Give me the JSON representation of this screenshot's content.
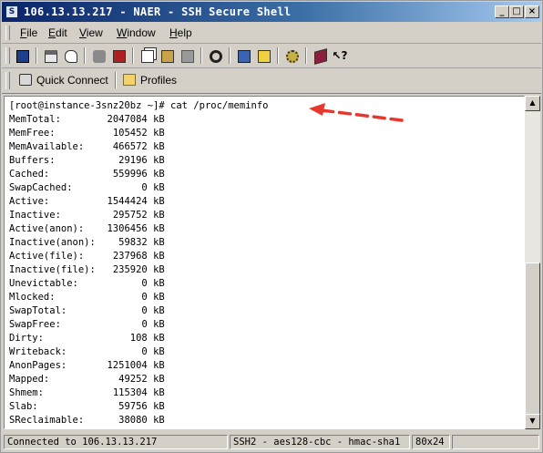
{
  "window": {
    "title": "106.13.13.217 - NAER - SSH Secure Shell",
    "controls": {
      "minimize": "_",
      "maximize": "□",
      "close": "×"
    }
  },
  "menu": [
    {
      "label": "File",
      "accel": "F",
      "rest": "ile"
    },
    {
      "label": "Edit",
      "accel": "E",
      "rest": "dit"
    },
    {
      "label": "View",
      "accel": "V",
      "rest": "iew"
    },
    {
      "label": "Window",
      "accel": "W",
      "rest": "indow"
    },
    {
      "label": "Help",
      "accel": "H",
      "rest": "elp"
    }
  ],
  "toolbar": {
    "icons": [
      "save-icon",
      "print-icon",
      "print-preview-icon",
      "disconnect-icon",
      "new-connection-icon",
      "copy-icon",
      "paste-icon",
      "paste-special-icon",
      "find-icon",
      "file-transfer-icon",
      "new-window-icon",
      "settings-icon",
      "book-icon",
      "help-icon"
    ]
  },
  "quickbar": {
    "quick_connect": "Quick Connect",
    "profiles": "Profiles"
  },
  "terminal": {
    "prompt": "[root@instance-3snz20bz ~]#",
    "command": "cat /proc/meminfo",
    "rows": [
      {
        "key": "MemTotal:",
        "value": "2047084",
        "unit": "kB"
      },
      {
        "key": "MemFree:",
        "value": "105452",
        "unit": "kB"
      },
      {
        "key": "MemAvailable:",
        "value": "466572",
        "unit": "kB"
      },
      {
        "key": "Buffers:",
        "value": "29196",
        "unit": "kB"
      },
      {
        "key": "Cached:",
        "value": "559996",
        "unit": "kB"
      },
      {
        "key": "SwapCached:",
        "value": "0",
        "unit": "kB"
      },
      {
        "key": "Active:",
        "value": "1544424",
        "unit": "kB"
      },
      {
        "key": "Inactive:",
        "value": "295752",
        "unit": "kB"
      },
      {
        "key": "Active(anon):",
        "value": "1306456",
        "unit": "kB"
      },
      {
        "key": "Inactive(anon):",
        "value": "59832",
        "unit": "kB"
      },
      {
        "key": "Active(file):",
        "value": "237968",
        "unit": "kB"
      },
      {
        "key": "Inactive(file):",
        "value": "235920",
        "unit": "kB"
      },
      {
        "key": "Unevictable:",
        "value": "0",
        "unit": "kB"
      },
      {
        "key": "Mlocked:",
        "value": "0",
        "unit": "kB"
      },
      {
        "key": "SwapTotal:",
        "value": "0",
        "unit": "kB"
      },
      {
        "key": "SwapFree:",
        "value": "0",
        "unit": "kB"
      },
      {
        "key": "Dirty:",
        "value": "108",
        "unit": "kB"
      },
      {
        "key": "Writeback:",
        "value": "0",
        "unit": "kB"
      },
      {
        "key": "AnonPages:",
        "value": "1251004",
        "unit": "kB"
      },
      {
        "key": "Mapped:",
        "value": "49252",
        "unit": "kB"
      },
      {
        "key": "Shmem:",
        "value": "115304",
        "unit": "kB"
      },
      {
        "key": "Slab:",
        "value": "59756",
        "unit": "kB"
      },
      {
        "key": "SReclaimable:",
        "value": "38080",
        "unit": "kB"
      }
    ]
  },
  "annotation": {
    "arrow_color": "#e8372c"
  },
  "status": {
    "connection": "Connected to 106.13.13.217",
    "cipher": "SSH2 - aes128-cbc - hmac-sha1",
    "size": "80x24"
  }
}
